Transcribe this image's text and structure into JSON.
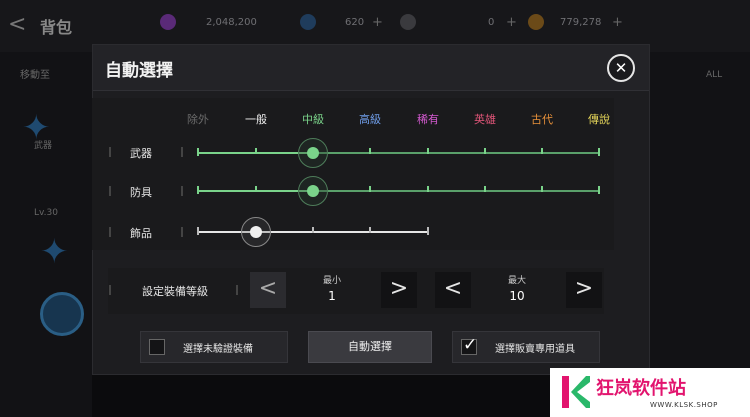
{
  "background": {
    "title": "背包",
    "back_glyph": "<",
    "currencies": [
      {
        "value": "2,048,200",
        "color": "#8a3fb5"
      },
      {
        "value": "620",
        "color": "#2f5c8a"
      },
      {
        "value": "0",
        "color": "#7a7a7a"
      },
      {
        "value": "779,278",
        "color": "#b8862a"
      }
    ],
    "plus": "+",
    "left_tab": "移動至",
    "level_text": "Lv.30",
    "weapon_tag": "武器",
    "right_all": "ALL"
  },
  "dialog": {
    "title": "自動選擇",
    "close_glyph": "✕",
    "grades": [
      {
        "label": "除外",
        "color": "#6b6b6b"
      },
      {
        "label": "一般",
        "color": "#f0f0f0"
      },
      {
        "label": "中級",
        "color": "#7ad38a"
      },
      {
        "label": "高級",
        "color": "#6f9de8"
      },
      {
        "label": "稀有",
        "color": "#d45ad0"
      },
      {
        "label": "英雄",
        "color": "#e05578"
      },
      {
        "label": "古代",
        "color": "#e8913a"
      },
      {
        "label": "傳說",
        "color": "#e8d85a"
      }
    ],
    "rows": [
      {
        "label": "武器",
        "level": 2
      },
      {
        "label": "防具",
        "level": 2
      },
      {
        "label": "飾品",
        "level": 1
      }
    ],
    "level_setting": {
      "label": "設定裝備等級",
      "min_label": "最小",
      "min_value": "1",
      "max_label": "最大",
      "max_value": "10",
      "left_glyph": "<",
      "right_glyph": ">"
    },
    "unverified_label": "選擇未驗證裝備",
    "unverified_checked": false,
    "auto_button": "自動選擇",
    "sale_label": "選擇販賣專用道具",
    "sale_checked": true,
    "check_glyph": "✓"
  },
  "watermark": {
    "text": "狂岚软件站",
    "url": "WWW.KLSK.SHOP"
  }
}
